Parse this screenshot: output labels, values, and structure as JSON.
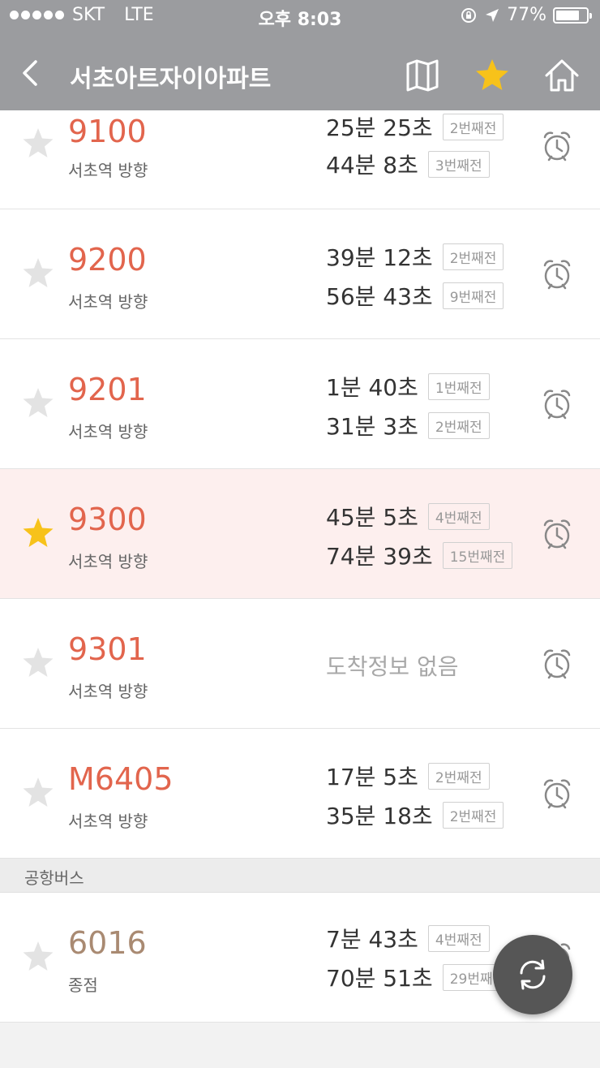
{
  "status_bar": {
    "carrier": "SKT",
    "network": "LTE",
    "time": "오후 8:03",
    "battery_percent": "77%",
    "battery_level": 0.77
  },
  "navbar": {
    "title": "서초아트자이아파트",
    "icons": [
      "back-chevron-icon",
      "map-icon",
      "star-icon",
      "home-icon"
    ],
    "favorite_active": true
  },
  "colors": {
    "header_bg": "#9b9c9f",
    "route_red": "#e2654d",
    "route_brown": "#a98a72",
    "star_gold": "#f7c21a",
    "highlight_bg": "#fdefee"
  },
  "routes": [
    {
      "number": "9100",
      "direction": "서초역 방향",
      "favorite": false,
      "arrivals": [
        {
          "time": "25분 25초",
          "stops": "2번째전"
        },
        {
          "time": "44분 8초",
          "stops": "3번째전"
        }
      ]
    },
    {
      "number": "9200",
      "direction": "서초역 방향",
      "favorite": false,
      "arrivals": [
        {
          "time": "39분 12초",
          "stops": "2번째전"
        },
        {
          "time": "56분 43초",
          "stops": "9번째전"
        }
      ]
    },
    {
      "number": "9201",
      "direction": "서초역 방향",
      "favorite": false,
      "arrivals": [
        {
          "time": "1분 40초",
          "stops": "1번째전"
        },
        {
          "time": "31분 3초",
          "stops": "2번째전"
        }
      ]
    },
    {
      "number": "9300",
      "direction": "서초역 방향",
      "favorite": true,
      "arrivals": [
        {
          "time": "45분 5초",
          "stops": "4번째전"
        },
        {
          "time": "74분 39초",
          "stops": "15번째전"
        }
      ]
    },
    {
      "number": "9301",
      "direction": "서초역 방향",
      "favorite": false,
      "no_info": "도착정보 없음"
    },
    {
      "number": "M6405",
      "direction": "서초역 방향",
      "favorite": false,
      "arrivals": [
        {
          "time": "17분 5초",
          "stops": "2번째전"
        },
        {
          "time": "35분 18초",
          "stops": "2번째전"
        }
      ]
    }
  ],
  "section": {
    "label": "공항버스"
  },
  "airport_routes": [
    {
      "number": "6016",
      "direction": "종점",
      "favorite": false,
      "arrivals": [
        {
          "time": "7분 43초",
          "stops": "4번째전"
        },
        {
          "time": "70분 51초",
          "stops": "29번째전"
        }
      ]
    }
  ],
  "fab": {
    "icon": "refresh-icon"
  }
}
